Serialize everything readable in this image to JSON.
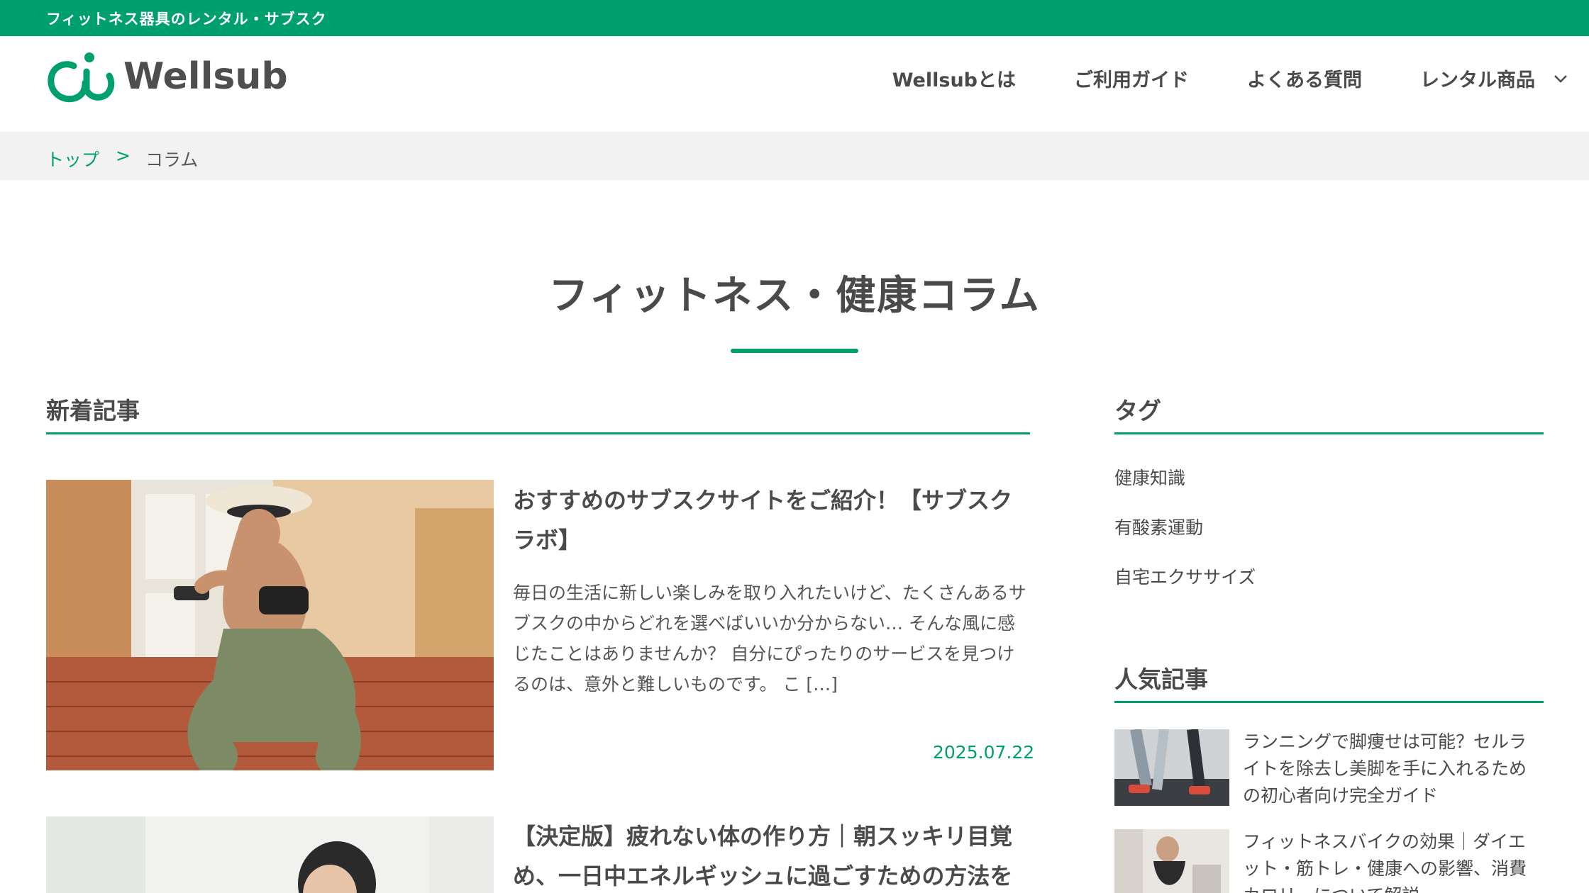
{
  "topbar": {
    "text": "フィットネス器具のレンタル・サブスク"
  },
  "header": {
    "logo_text": "Wellsub",
    "nav": [
      {
        "label": "Wellsubとは"
      },
      {
        "label": "ご利用ガイド"
      },
      {
        "label": "よくある質問"
      },
      {
        "label": "レンタル商品"
      }
    ]
  },
  "breadcrumb": {
    "home": "トップ",
    "separator": ">",
    "current": "コラム"
  },
  "page": {
    "title": "フィットネス・健康コラム"
  },
  "new_articles": {
    "heading": "新着記事",
    "items": [
      {
        "title": "おすすめのサブスクサイトをご紹介！【サブスクラボ】",
        "excerpt": "毎日の生活に新しい楽しみを取り入れたいけど、たくさんあるサブスクの中からどれを選べばいいか分からない… そんな風に感じたことはありませんか？ 自分にぴったりのサービスを見つけるのは、意外と難しいものです。 こ […]",
        "date": "2025.07.22"
      },
      {
        "title": "【決定版】疲れない体の作り方｜朝スッキリ目覚め、一日中エネルギッシュに過ごすための方法を"
      }
    ]
  },
  "sidebar": {
    "tags_heading": "タグ",
    "tags": [
      "健康知識",
      "有酸素運動",
      "自宅エクササイズ"
    ],
    "popular_heading": "人気記事",
    "popular": [
      {
        "title": "ランニングで脚痩せは可能？セルライトを除去し美脚を手に入れるための初心者向け完全ガイド"
      },
      {
        "title": "フィットネスバイクの効果｜ダイエット・筋トレ・健康への影響、消費カロリーについて解説"
      }
    ]
  },
  "colors": {
    "brand_green": "#00a06e",
    "text": "#4a4a4a",
    "breadcrumb_bg": "#f2f2f2"
  }
}
